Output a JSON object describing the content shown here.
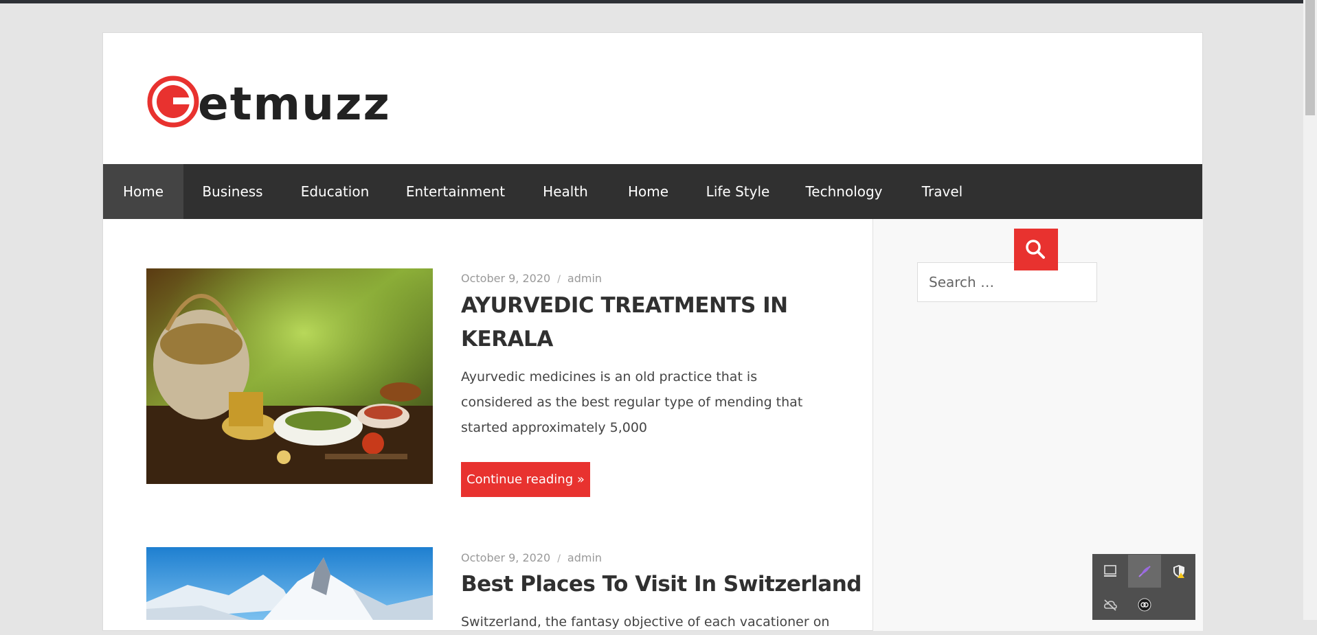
{
  "site": {
    "logo_text": "Getmuzz",
    "brand_color": "#e8322f"
  },
  "nav": {
    "items": [
      {
        "label": "Home",
        "active": true
      },
      {
        "label": "Business"
      },
      {
        "label": "Education"
      },
      {
        "label": "Entertainment"
      },
      {
        "label": "Health"
      },
      {
        "label": "Home"
      },
      {
        "label": "Life Style"
      },
      {
        "label": "Technology"
      },
      {
        "label": "Travel"
      }
    ]
  },
  "search": {
    "placeholder": "Search …",
    "icon": "search-icon"
  },
  "posts": [
    {
      "date": "October 9, 2020",
      "author": "admin",
      "title": "AYURVEDIC TREATMENTS IN KERALA",
      "excerpt": "Ayurvedic medicines is an old practice that is considered as the best regular type of mending that started approximately 5,000",
      "more_label": "Continue reading »"
    },
    {
      "date": "October 9, 2020",
      "author": "admin",
      "title": "Best Places To Visit In Switzerland",
      "excerpt": "Switzerland, the fantasy objective of each vacationer on"
    }
  ],
  "tray": {
    "icons": [
      "screen-icon",
      "feather-icon",
      "shield-warning-icon",
      "cloud-off-icon",
      "app-badge-icon"
    ]
  }
}
